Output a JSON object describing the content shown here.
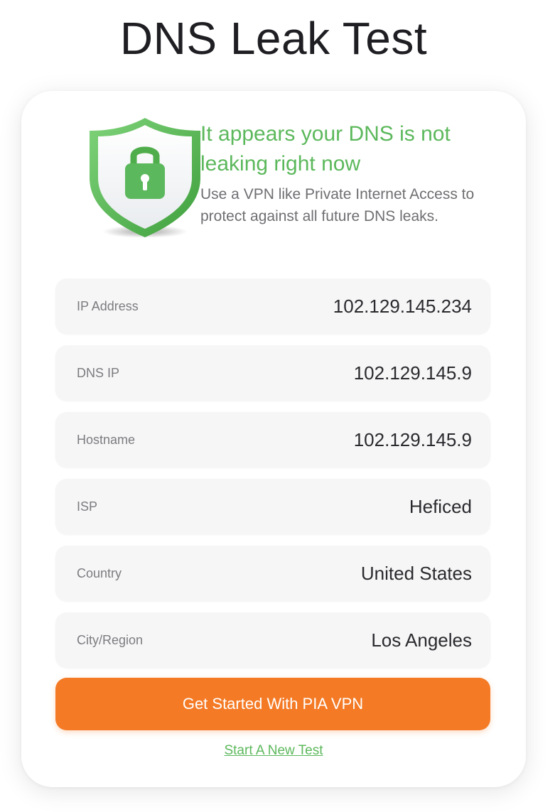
{
  "page": {
    "title": "DNS Leak Test"
  },
  "status": {
    "headline": "It appears your DNS is not leaking right now",
    "description": "Use a VPN like Private Internet Access to protect against all future DNS leaks.",
    "icon": "shield-lock-icon",
    "color": "#5cb85c"
  },
  "details": [
    {
      "label": "IP Address",
      "value": "102.129.145.234"
    },
    {
      "label": "DNS IP",
      "value": "102.129.145.9"
    },
    {
      "label": "Hostname",
      "value": "102.129.145.9"
    },
    {
      "label": "ISP",
      "value": "Heficed"
    },
    {
      "label": "Country",
      "value": "United States"
    },
    {
      "label": "City/Region",
      "value": "Los Angeles"
    }
  ],
  "actions": {
    "primary_label": "Get Started With PIA VPN",
    "primary_color": "#f47a25",
    "secondary_label": "Start A New Test"
  }
}
